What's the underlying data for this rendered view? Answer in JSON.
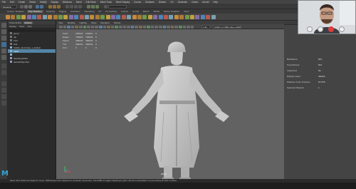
{
  "menubar": {
    "items": [
      "File",
      "Edit",
      "Create",
      "Select",
      "Modify",
      "Display",
      "Windows",
      "Mesh",
      "Edit Mesh",
      "Mesh Tools",
      "Mesh Display",
      "Curves",
      "Surfaces",
      "Deform",
      "UV",
      "Generate",
      "Cache",
      "Arnold",
      "Help"
    ]
  },
  "status_line": {
    "mode_dropdown": "Modeling",
    "search_placeholder": "Sign In"
  },
  "shelf_tabs": [
    {
      "label": "Curves / Surfaces",
      "active": false
    },
    {
      "label": "Poly Modeling",
      "active": true
    },
    {
      "label": "Sculpting",
      "active": false
    },
    {
      "label": "Rigging",
      "active": false
    },
    {
      "label": "Animation",
      "active": false
    },
    {
      "label": "Rendering",
      "active": false
    },
    {
      "label": "FX",
      "active": false
    },
    {
      "label": "FX Caching",
      "active": false
    },
    {
      "label": "Custom",
      "active": false
    },
    {
      "label": "Arnold",
      "active": false
    },
    {
      "label": "Bifrost",
      "active": false
    },
    {
      "label": "MASH",
      "active": false
    },
    {
      "label": "Motion Graphics",
      "active": false
    },
    {
      "label": "XGen",
      "active": false
    }
  ],
  "outliner": {
    "tabs": [
      {
        "label": "Channel Box",
        "active": false
      },
      {
        "label": "Outliner",
        "active": true
      }
    ],
    "menu": [
      "Display",
      "Show",
      "Help"
    ],
    "rows": [
      {
        "label": "persp",
        "color": "#7a7a7a",
        "selected": false
      },
      {
        "label": "top",
        "color": "#7a7a7a",
        "selected": false
      },
      {
        "label": "front",
        "color": "#7a7a7a",
        "selected": false
      },
      {
        "label": "side",
        "color": "#7a7a7a",
        "selected": false
      },
      {
        "label": "Soldier_Decimate_1_default",
        "color": "#8cb0d0",
        "selected": false
      },
      {
        "label": "mesh",
        "color": "#8cb0d0",
        "selected": true
      },
      {
        "label": "",
        "color": "#8cb0d0",
        "selected": false
      },
      {
        "label": "defaultLightSet",
        "color": "#9aa0c8",
        "selected": false
      },
      {
        "label": "defaultObjectSet",
        "color": "#9aa0c8",
        "selected": false
      }
    ]
  },
  "viewport": {
    "menu": [
      "View",
      "Shading",
      "Lighting",
      "Show",
      "Renderer",
      "Panels"
    ],
    "hud": [
      {
        "k": "Verts:",
        "a": "249616",
        "b": "249616",
        "c": "0"
      },
      {
        "k": "Edges:",
        "a": "748836",
        "b": "748836",
        "c": "0"
      },
      {
        "k": "Faces:",
        "a": "499232",
        "b": "499232",
        "c": "0"
      },
      {
        "k": "Tris:",
        "a": "499232",
        "b": "499232",
        "c": "0"
      },
      {
        "k": "UVs:",
        "a": "0",
        "b": "0",
        "c": "0"
      }
    ],
    "camera_label": "persp",
    "colorspace": "ACES 1.0 SDR-video (sRGB)",
    "gamma": "1.00"
  },
  "hud_panel": {
    "rows": [
      {
        "k": "Backfaces:",
        "v": "N/A"
      },
      {
        "k": "Smoothness:",
        "v": "N/A"
      },
      {
        "k": "Instanced:",
        "v": "No"
      },
      {
        "k": "Display Layer:",
        "v": "default"
      },
      {
        "k": "Distance From Camera:",
        "v": "67.575"
      },
      {
        "k": "Selected Objects:",
        "v": "1"
      }
    ]
  },
  "help_line": "Move Tool: Select an object to move. Shift+drag in the viewport to constrain movement. Ctrl+LMB to toggle snapping to grid. Use the manipulator to move along an axis or plane.",
  "colors": {
    "accent": "#5285a6",
    "call_end": "#e23c3c",
    "maya_logo": "#2fa6d8"
  }
}
